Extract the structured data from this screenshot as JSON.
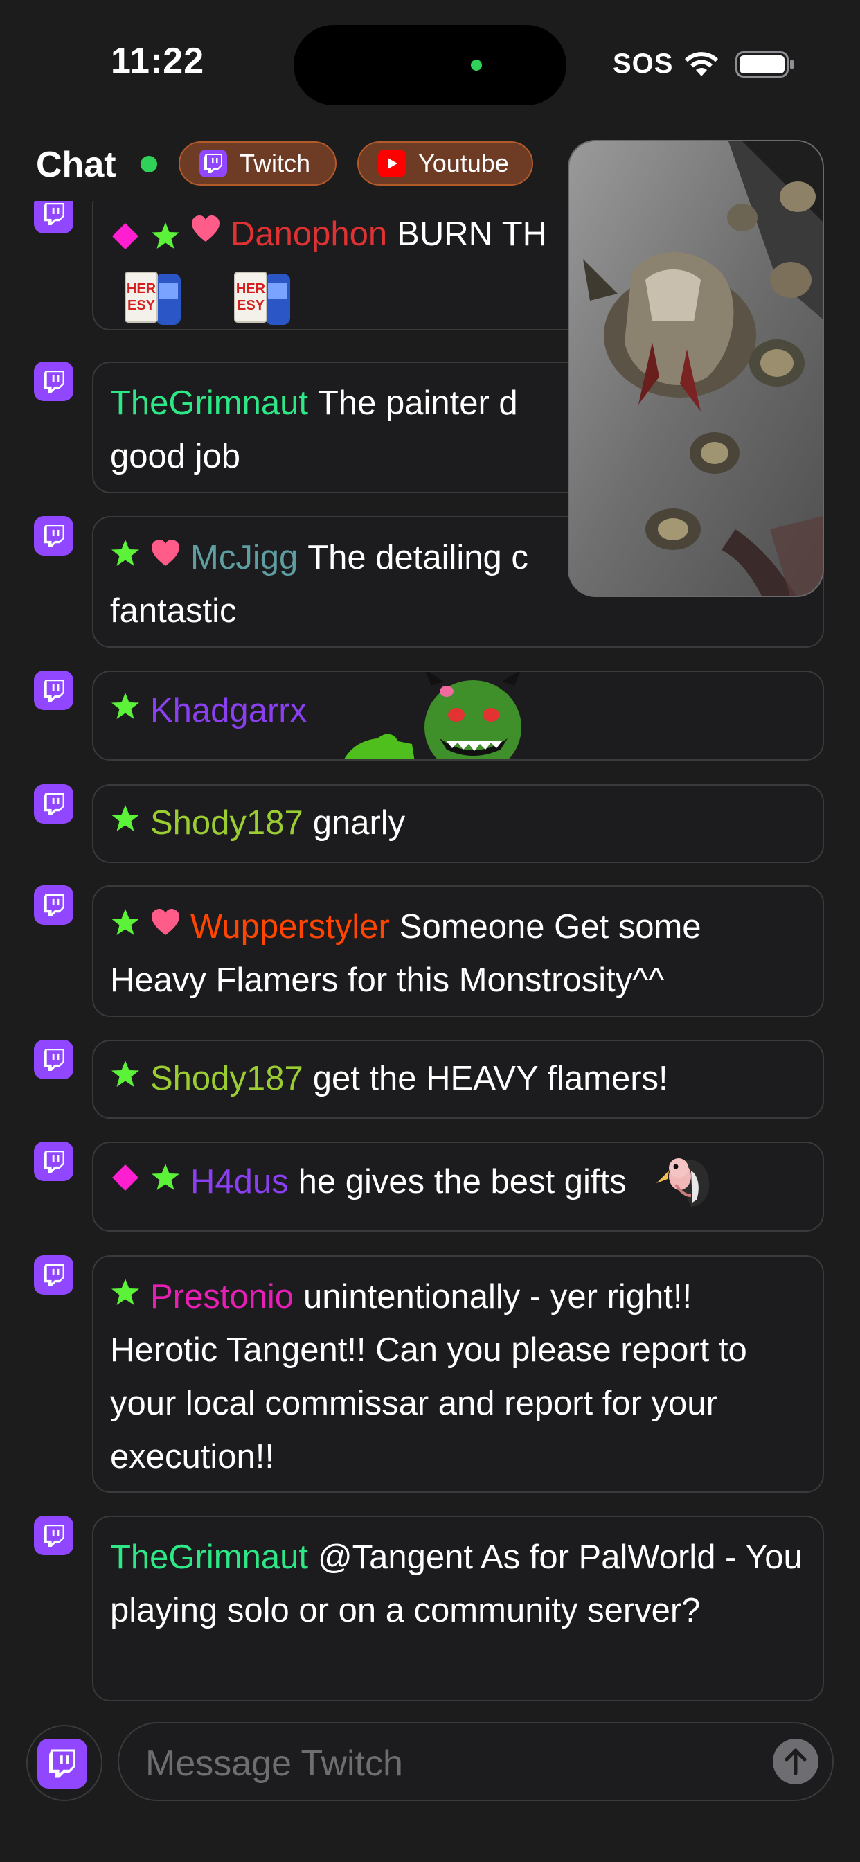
{
  "status_bar": {
    "time": "11:22",
    "sos": "SOS"
  },
  "header": {
    "title": "Chat",
    "platforms": [
      {
        "label": "Twitch",
        "icon": "twitch-icon",
        "color": "#9146ff"
      },
      {
        "label": "Youtube",
        "icon": "youtube-icon",
        "color": "#ff0000"
      }
    ]
  },
  "messages": [
    {
      "badges": [
        "diamond",
        "star",
        "heart"
      ],
      "user": "Danophon",
      "user_color": "#e03232",
      "text": "BURN TH",
      "emotes": [
        "heresy-emote",
        "heresy-emote"
      ]
    },
    {
      "badges": [],
      "user": "TheGrimnaut",
      "user_color": "#2ee887",
      "text": "The painter d good job"
    },
    {
      "badges": [
        "star",
        "heart"
      ],
      "user": "McJigg",
      "user_color": "#5f9ea0",
      "text": "The detailing c fantastic"
    },
    {
      "badges": [
        "star"
      ],
      "user": "Khadgarrx",
      "user_color": "#8a3ff0",
      "text": "",
      "emotes": [
        "goblin-emote"
      ]
    },
    {
      "badges": [
        "star"
      ],
      "user": "Shody187",
      "user_color": "#9acd32",
      "text": "gnarly"
    },
    {
      "badges": [
        "star",
        "heart"
      ],
      "user": "Wupperstyler",
      "user_color": "#ff4500",
      "text": "Someone Get some Heavy Flamers for this Monstrosity^^"
    },
    {
      "badges": [
        "star"
      ],
      "user": "Shody187",
      "user_color": "#9acd32",
      "text": "get the HEAVY flamers!"
    },
    {
      "badges": [
        "diamond",
        "star"
      ],
      "user": "H4dus",
      "user_color": "#8a3ff0",
      "text": "he gives the best gifts",
      "emotes": [
        "vulture-emote"
      ]
    },
    {
      "badges": [
        "star"
      ],
      "user": "Prestonio",
      "user_color": "#e620b4",
      "text": "unintentionally - yer right!! Herotic Tangent!! Can you please report to your local commissar and report for your execution!!"
    },
    {
      "badges": [],
      "user": "TheGrimnaut",
      "user_color": "#2ee887",
      "text": "@Tangent As for PalWorld - You playing solo or on a community server?"
    }
  ],
  "composer": {
    "placeholder": "Message Twitch"
  },
  "colors": {
    "twitch": "#9146ff",
    "youtube": "#ff0000",
    "star": "#5cf23a",
    "heart": "#ff5c8a",
    "diamond": "#ff1fd1",
    "background": "#1c1c1d"
  }
}
